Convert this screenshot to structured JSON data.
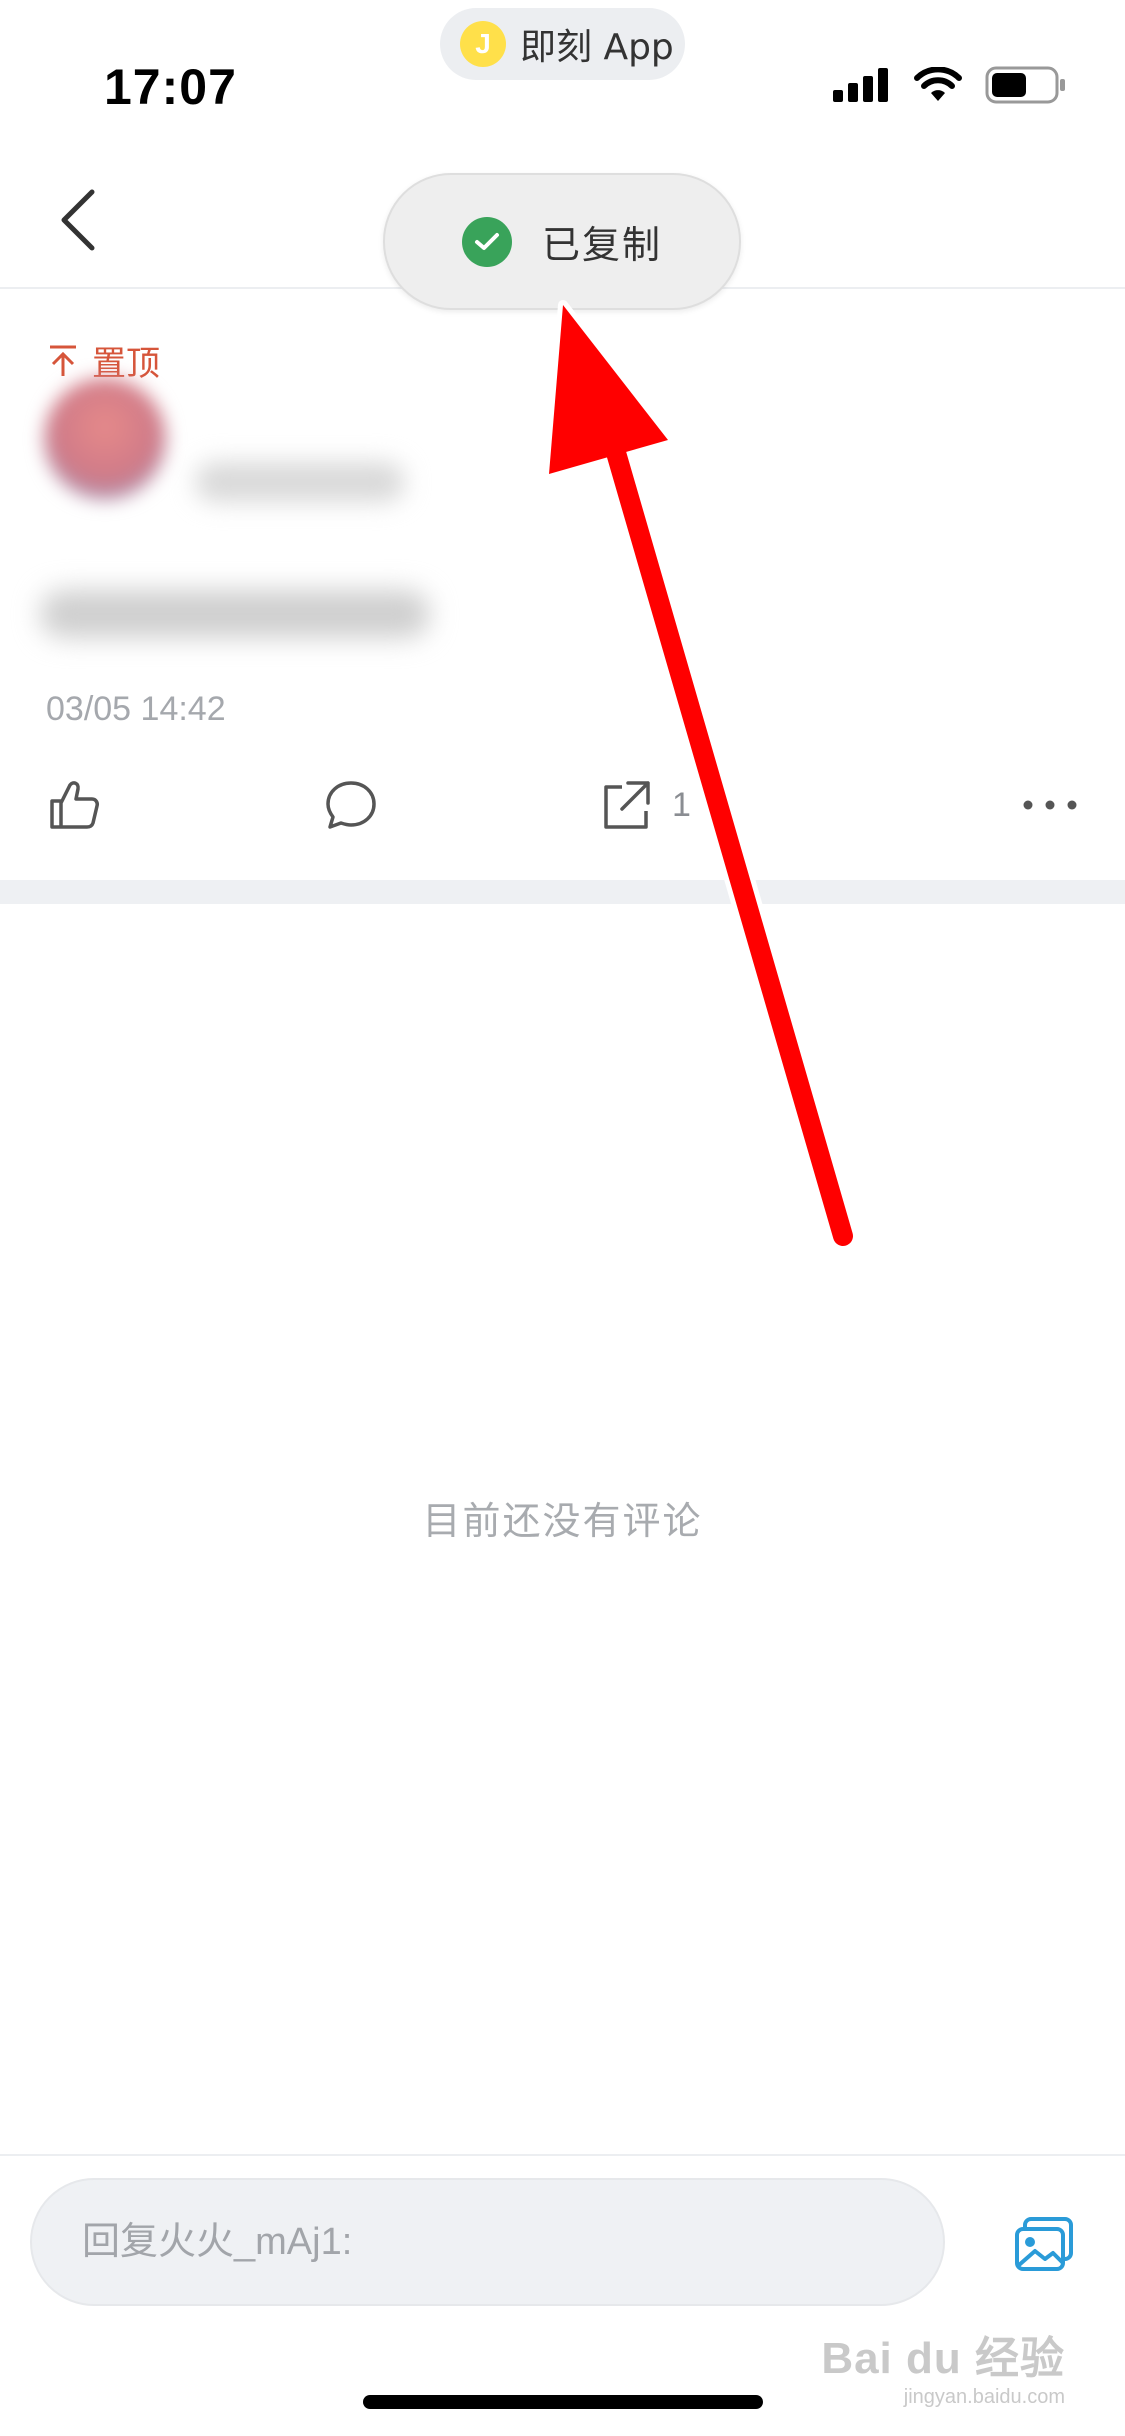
{
  "status_bar": {
    "time": "17:07",
    "app_pill": {
      "logo_letter": "J",
      "name": "即刻 App",
      "logo_color": "#ffe04a"
    }
  },
  "toast": {
    "label": "已复制",
    "icon": "check-circle-icon",
    "icon_color": "#39a35a"
  },
  "header": {
    "back_icon": "chevron-left-icon"
  },
  "post": {
    "pinned_label": "置顶",
    "accent_color": "#d6553a",
    "timestamp": "03/05 14:42",
    "actions": {
      "share_count": "1"
    }
  },
  "comments": {
    "empty_text": "目前还没有评论"
  },
  "reply_bar": {
    "placeholder": "回复火火_mAj1:",
    "image_icon": "image-icon"
  },
  "watermark": {
    "logo": "Bai du 经验",
    "url": "jingyan.baidu.com"
  },
  "annotation": {
    "arrow_color": "#ff0000"
  }
}
